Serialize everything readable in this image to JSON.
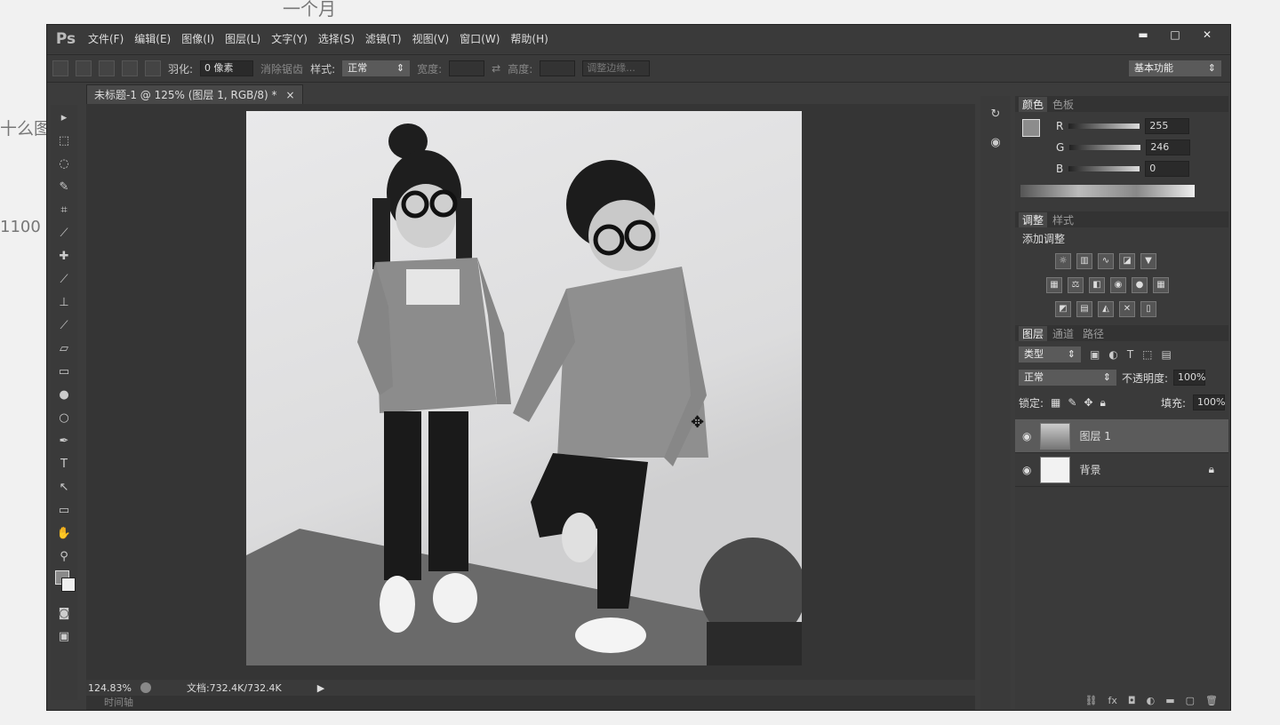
{
  "background": {
    "top_text": "一个月",
    "left_text_1": "十么图",
    "left_text_2": "1100"
  },
  "app": {
    "logo": "Ps"
  },
  "menu": [
    "文件(F)",
    "编辑(E)",
    "图像(I)",
    "图层(L)",
    "文字(Y)",
    "选择(S)",
    "滤镜(T)",
    "视图(V)",
    "窗口(W)",
    "帮助(H)"
  ],
  "window_controls": {
    "minimize": "▬",
    "maximize": "□",
    "close": "✕"
  },
  "options": {
    "feather_label": "羽化:",
    "feather_value": "0 像素",
    "antialias_label": "消除锯齿",
    "style_label": "样式:",
    "style_value": "正常",
    "width_label": "宽度:",
    "height_label": "高度:",
    "refine_edge": "调整边缘...",
    "workspace": "基本功能"
  },
  "document": {
    "tab_title": "未标题-1 @ 125% (图层 1, RGB/8) *",
    "tab_close": "×",
    "zoom": "124.83%",
    "doc_info": "文档:732.4K/732.4K",
    "timeline_label": "时间轴"
  },
  "color_panel": {
    "tabs": [
      "颜色",
      "色板"
    ],
    "channels": [
      {
        "label": "R",
        "value": "255"
      },
      {
        "label": "G",
        "value": "246"
      },
      {
        "label": "B",
        "value": "0"
      }
    ]
  },
  "adjust_panel": {
    "tabs": [
      "调整",
      "样式"
    ],
    "add_label": "添加调整"
  },
  "layers_panel": {
    "tabs": [
      "图层",
      "通道",
      "路径"
    ],
    "filter_kind": "类型",
    "blend_mode": "正常",
    "opacity_label": "不透明度:",
    "opacity_value": "100%",
    "lock_label": "锁定:",
    "fill_label": "填充:",
    "fill_value": "100%",
    "layers": [
      {
        "name": "图层 1",
        "selected": true
      },
      {
        "name": "背景",
        "selected": false
      }
    ]
  },
  "colors": {
    "chrome": "#3a3a3a",
    "canvas_bg": "#353535",
    "selected_layer": "#5b5b5b"
  }
}
